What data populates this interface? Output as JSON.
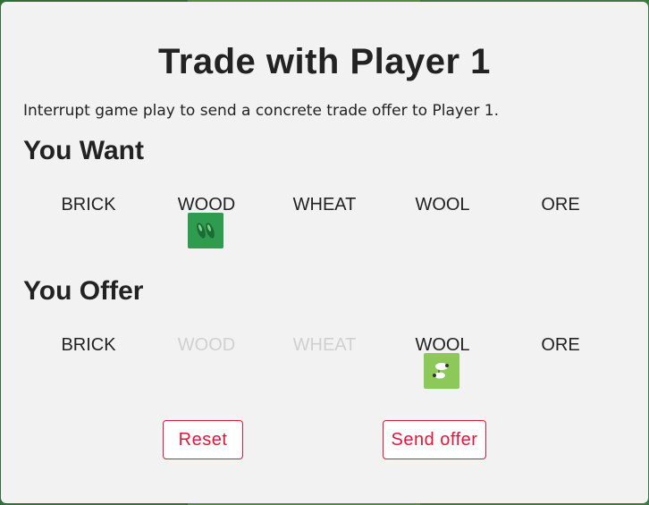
{
  "modal": {
    "title": "Trade with Player 1",
    "description": "Interrupt game play to send a concrete trade offer to Player 1."
  },
  "want": {
    "heading": "You Want",
    "resources": [
      {
        "label": "BRICK",
        "enabled": true,
        "selected": false
      },
      {
        "label": "WOOD",
        "enabled": true,
        "selected": true,
        "card": "wood-card-icon"
      },
      {
        "label": "WHEAT",
        "enabled": true,
        "selected": false
      },
      {
        "label": "WOOL",
        "enabled": true,
        "selected": false
      },
      {
        "label": "ORE",
        "enabled": true,
        "selected": false
      }
    ]
  },
  "offer": {
    "heading": "You Offer",
    "resources": [
      {
        "label": "BRICK",
        "enabled": true,
        "selected": false
      },
      {
        "label": "WOOD",
        "enabled": false,
        "selected": false
      },
      {
        "label": "WHEAT",
        "enabled": false,
        "selected": false
      },
      {
        "label": "WOOL",
        "enabled": true,
        "selected": true,
        "card": "wool-card-icon"
      },
      {
        "label": "ORE",
        "enabled": true,
        "selected": false
      }
    ]
  },
  "actions": {
    "reset_label": "Reset",
    "send_label": "Send offer"
  },
  "colors": {
    "accent": "#e0163a",
    "wood_card": "#2e9b4f",
    "wool_card": "#8cc85a",
    "disabled_text": "#d0d0d0"
  }
}
